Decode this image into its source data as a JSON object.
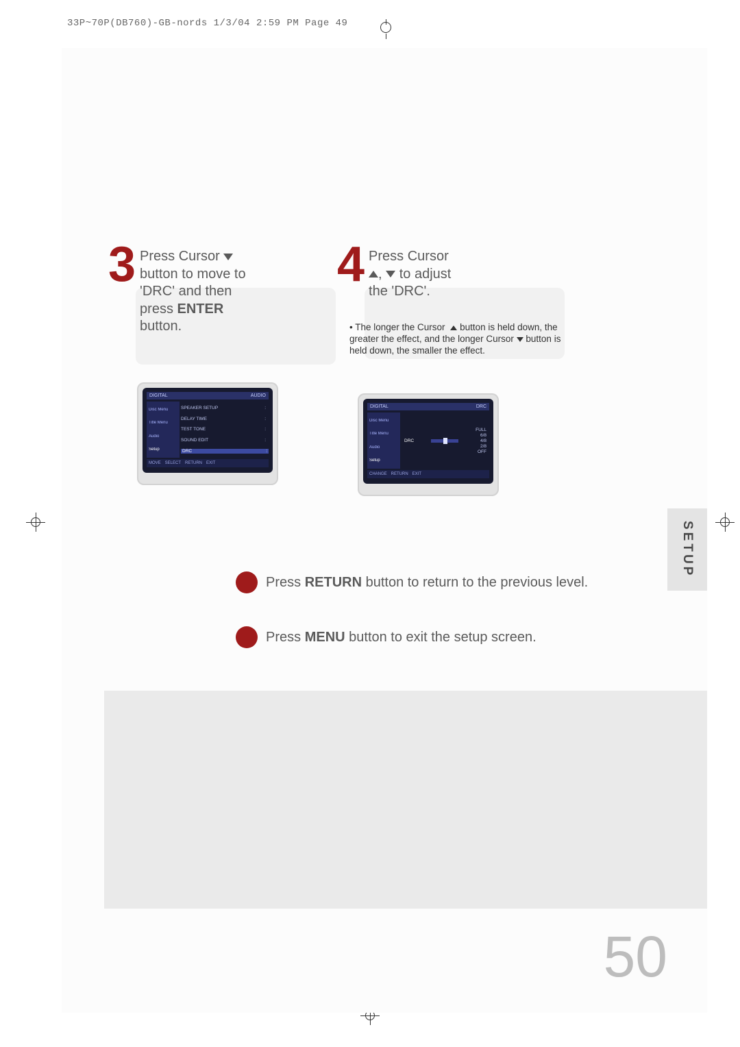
{
  "header": "33P~70P(DB760)-GB-nords  1/3/04 2:59 PM  Page 49",
  "step3": {
    "num": "3",
    "line1_a": "Press Cursor ",
    "line2": "button to move to",
    "line3": "'DRC' and then",
    "line4a": "press ",
    "line4b": "ENTER",
    "line5": "button."
  },
  "step4": {
    "num": "4",
    "line1": "Press Cursor",
    "line2_a": ", ",
    "line2_b": " to adjust",
    "line3": "the 'DRC'."
  },
  "note4": {
    "pre": "• The longer the Cursor ",
    "mid": " button is held down, the greater the effect, and the longer Cursor ",
    "post": " button is held down, the smaller the effect."
  },
  "tvA": {
    "hdr_l": "DIGITAL",
    "hdr_r": "AUDIO",
    "side": [
      "Disc Menu",
      "Title Menu",
      "Audio",
      "Setup"
    ],
    "rows": [
      {
        "l": "SPEAKER SETUP",
        "r": ":"
      },
      {
        "l": "DELAY TIME",
        "r": ":"
      },
      {
        "l": "TEST TONE",
        "r": ":"
      },
      {
        "l": "SOUND EDIT",
        "r": ":"
      },
      {
        "l": "DRC",
        "r": ":  "
      }
    ],
    "foot": [
      "MOVE",
      "SELECT",
      "RETURN",
      "EXIT"
    ]
  },
  "tvB": {
    "hdr_l": "DIGITAL",
    "hdr_r": "DRC",
    "side": [
      "Disc Menu",
      "Title Menu",
      "Audio",
      "Setup"
    ],
    "label": "DRC",
    "vals": [
      "FULL",
      "6/8",
      "4/8",
      "2/8",
      "OFF"
    ],
    "foot": [
      "CHANGE",
      "RETURN",
      "EXIT"
    ]
  },
  "returnNote": {
    "pre": "Press ",
    "bold": "RETURN",
    "post": " button to return to the previous level."
  },
  "menuNote": {
    "pre": "Press ",
    "bold": "MENU",
    "post": " button to exit the setup screen."
  },
  "sideTab": "SETUP",
  "pageNum": "50"
}
